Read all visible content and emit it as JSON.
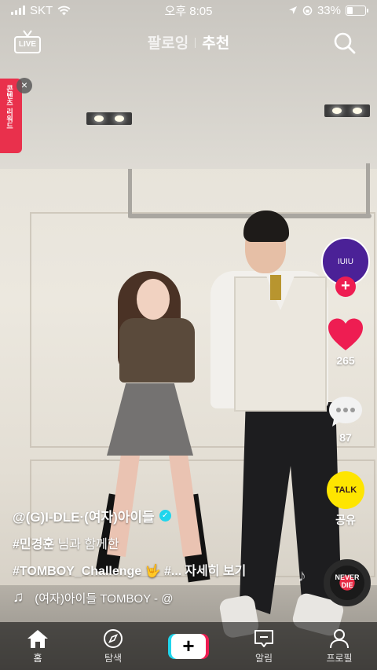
{
  "status_bar": {
    "carrier": "SKT",
    "time": "오후 8:05",
    "battery_percent": "33%",
    "battery_level": 0.33
  },
  "top_nav": {
    "live_label": "LIVE",
    "tab_following": "팔로잉",
    "tab_for_you": "추천",
    "search_icon": "search-icon"
  },
  "promo": {
    "text": "콘텐츠 리워드",
    "close": "×"
  },
  "creator": {
    "avatar_text": "IUIU",
    "follow_plus": "+"
  },
  "actions": {
    "likes": "265",
    "comments": "87",
    "share_badge": "TALK",
    "share_label": "공유"
  },
  "caption": {
    "author": "@(G)I-DLE·(여자)아이들",
    "mention": "#민경훈",
    "mention_suffix": " 님과 함께한",
    "hashtags": "#TOMBOY_Challenge 🤟 #...",
    "more": "자세히 보기"
  },
  "music": {
    "note": "♫",
    "text": "(여자)아이들   TOMBOY - @",
    "disc_label": "NEVER DIE"
  },
  "tab_bar": {
    "home": "홈",
    "discover": "탐색",
    "create": "+",
    "inbox": "알림",
    "profile": "프로필"
  },
  "colors": {
    "like_red": "#ee1d52",
    "tiktok_cyan": "#20d5ec",
    "kakao_yellow": "#fee500",
    "avatar_purple": "#4b2197"
  }
}
